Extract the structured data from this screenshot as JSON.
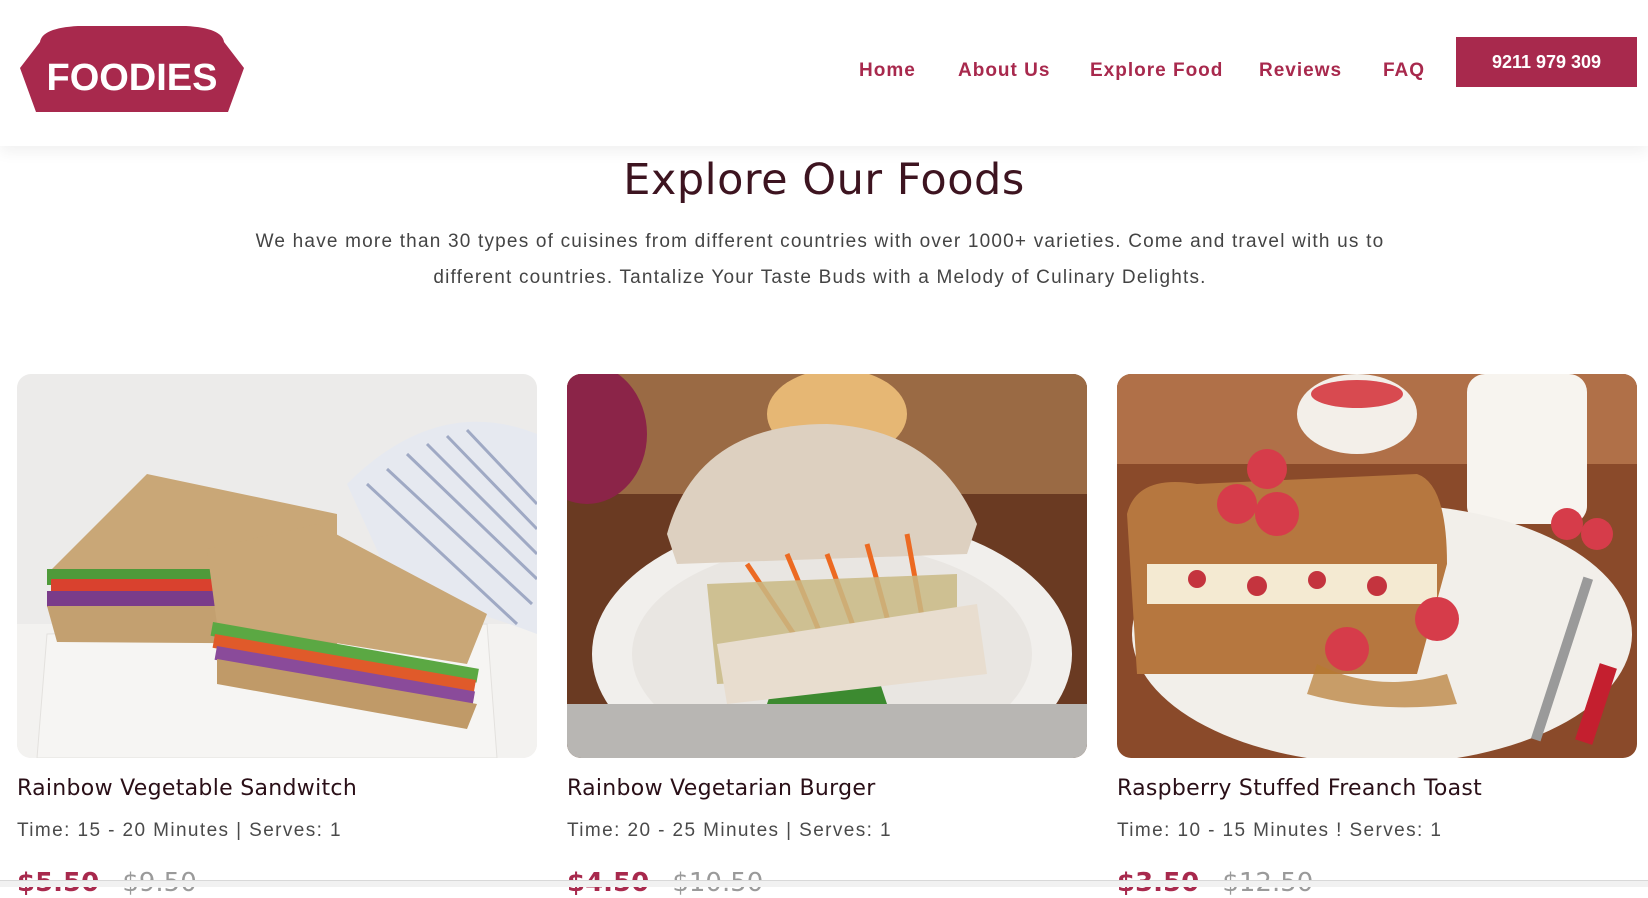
{
  "brand": {
    "logo_text": "FOODIES",
    "color": "#a8294d"
  },
  "nav": {
    "items": [
      {
        "label": "Home"
      },
      {
        "label": "About Us"
      },
      {
        "label": "Explore Food"
      },
      {
        "label": "Reviews"
      },
      {
        "label": "FAQ"
      }
    ],
    "phone_label": "9211 979 309"
  },
  "section": {
    "title": "Explore Our Foods",
    "description": "We have more than 30 types of cuisines from different countries with over 1000+ varieties. Come and travel with us to different countries. Tantalize Your Taste Buds with a Melody of Culinary Delights."
  },
  "foods": [
    {
      "title": "Rainbow Vegetable Sandwitch",
      "meta": "Time: 15 - 20 Minutes | Serves: 1",
      "price_now": "$5.50",
      "price_old": "$9.50"
    },
    {
      "title": "Rainbow Vegetarian Burger",
      "meta": "Time: 20 - 25 Minutes | Serves: 1",
      "price_now": "$4.50",
      "price_old": "$10.50"
    },
    {
      "title": "Raspberry Stuffed Freanch Toast",
      "meta": "Time: 10 - 15 Minutes ! Serves: 1",
      "price_now": "$3.50",
      "price_old": "$12.50"
    }
  ]
}
